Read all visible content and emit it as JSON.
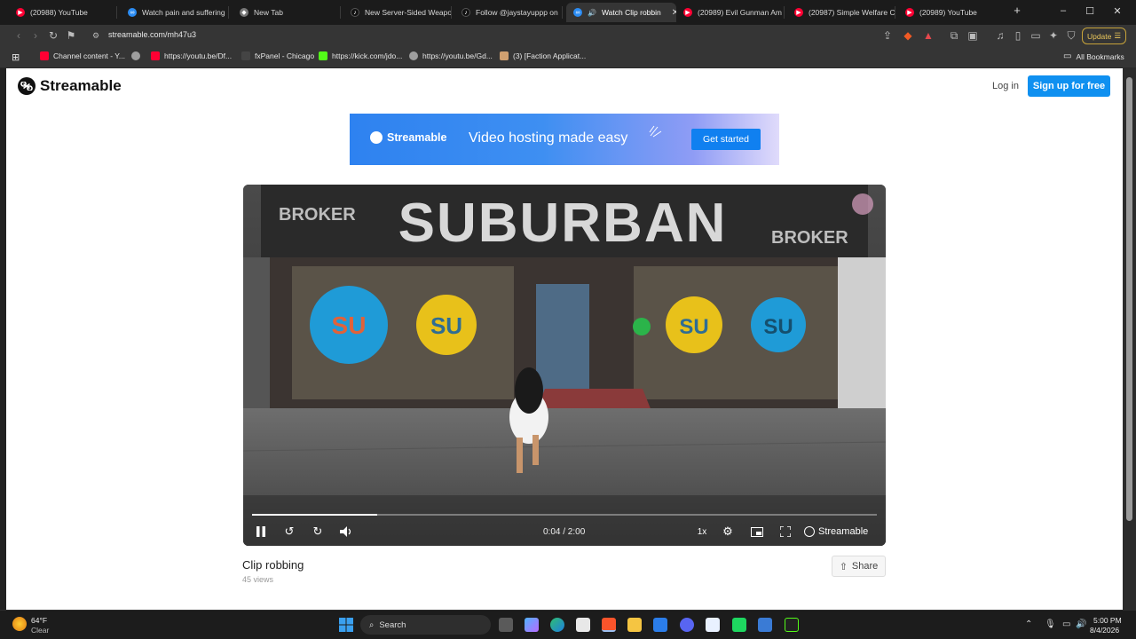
{
  "browser": {
    "tabs": [
      {
        "title": "(20988) YouTube",
        "icon": "youtube-icon",
        "color": "#ff0033"
      },
      {
        "title": "Watch pain and suffering",
        "icon": "streamable-icon",
        "color": "#2b8cf3"
      },
      {
        "title": "New Tab",
        "icon": "brave-shield-icon",
        "color": "#888888"
      },
      {
        "title": "New Server-Sided Weapo",
        "icon": "tiktok-icon",
        "color": "#111111"
      },
      {
        "title": "Follow @jaystayuppp on",
        "icon": "tiktok-icon",
        "color": "#111111"
      },
      {
        "title": "Watch Clip robbin",
        "icon": "streamable-icon",
        "color": "#2b8cf3",
        "active": true
      },
      {
        "title": "(20989) Evil Gunman Am",
        "icon": "youtube-icon",
        "color": "#ff0033"
      },
      {
        "title": "(20987) Simple Welfare C",
        "icon": "youtube-icon",
        "color": "#ff0033"
      },
      {
        "title": "(20989) YouTube",
        "icon": "youtube-icon",
        "color": "#ff0033"
      }
    ],
    "new_tab": "+",
    "window_controls": {
      "minimize": "–",
      "maximize": "☐",
      "close": "✕"
    },
    "url": "streamable.com/mh47u3",
    "update_label": "Update",
    "bookmarks": [
      {
        "label": "Channel content - Y...",
        "color": "#ff0033"
      },
      {
        "label": "",
        "color": "#9e9e9e"
      },
      {
        "label": "https://youtu.be/Df...",
        "color": "#ff0033"
      },
      {
        "label": "fxPanel - Chicago",
        "color": "#444444"
      },
      {
        "label": "https://kick.com/jdo...",
        "color": "#53fc18"
      },
      {
        "label": "https://youtu.be/Gd...",
        "color": "#9e9e9e"
      },
      {
        "label": "(3) [Faction Applicat...",
        "color": "#d0a070"
      }
    ],
    "all_bookmarks": "All Bookmarks"
  },
  "site": {
    "logo_text": "Streamable",
    "login": "Log in",
    "signup": "Sign up for free",
    "banner": {
      "brand": "Streamable",
      "tagline": "Video hosting made easy",
      "cta": "Get started"
    },
    "player": {
      "scene_sign": "SUBURBAN",
      "side_sign_left": "BROKER",
      "side_sign_right": "BROKER",
      "logo_letters": "SU",
      "time": "0:04 / 2:00",
      "speed": "1x",
      "brand": "Streamable",
      "progress": 0.2,
      "accent": "#ffffff"
    },
    "clip_title": "Clip robbing",
    "views": "45 views",
    "share": "Share"
  },
  "taskbar": {
    "temp": "64°F",
    "condition": "Clear",
    "search": "Search",
    "time": "5:00 PM",
    "date": "8/4/2026"
  }
}
